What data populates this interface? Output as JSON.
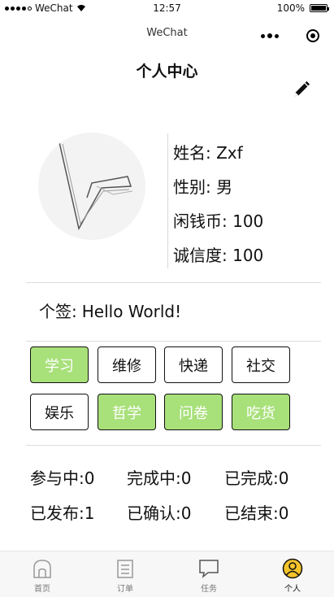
{
  "status_bar": {
    "carrier": "WeChat",
    "time": "12:57",
    "battery": "100%"
  },
  "navbar": {
    "title": "WeChat"
  },
  "page": {
    "title": "个人中心"
  },
  "profile": {
    "name": "姓名: Zxf",
    "gender": "性别: 男",
    "coins": "闲钱币: 100",
    "credit": "诚信度: 100"
  },
  "signature": {
    "label": "个签:",
    "text": "Hello World!"
  },
  "tags": [
    {
      "label": "学习",
      "active": true
    },
    {
      "label": "维修",
      "active": false
    },
    {
      "label": "快递",
      "active": false
    },
    {
      "label": "社交",
      "active": false
    },
    {
      "label": "娱乐",
      "active": false
    },
    {
      "label": "哲学",
      "active": true
    },
    {
      "label": "问卷",
      "active": true
    },
    {
      "label": "吃货",
      "active": true
    }
  ],
  "stats": [
    "参与中:0",
    "完成中:0",
    "已完成:0",
    "已发布:1",
    "已确认:0",
    "已结束:0"
  ],
  "tabbar": {
    "items": [
      {
        "label": "首页",
        "icon": "home-icon"
      },
      {
        "label": "订单",
        "icon": "order-icon"
      },
      {
        "label": "任务",
        "icon": "chat-icon"
      },
      {
        "label": "个人",
        "icon": "user-icon"
      }
    ]
  },
  "colors": {
    "tag_active": "#a8e07a"
  }
}
